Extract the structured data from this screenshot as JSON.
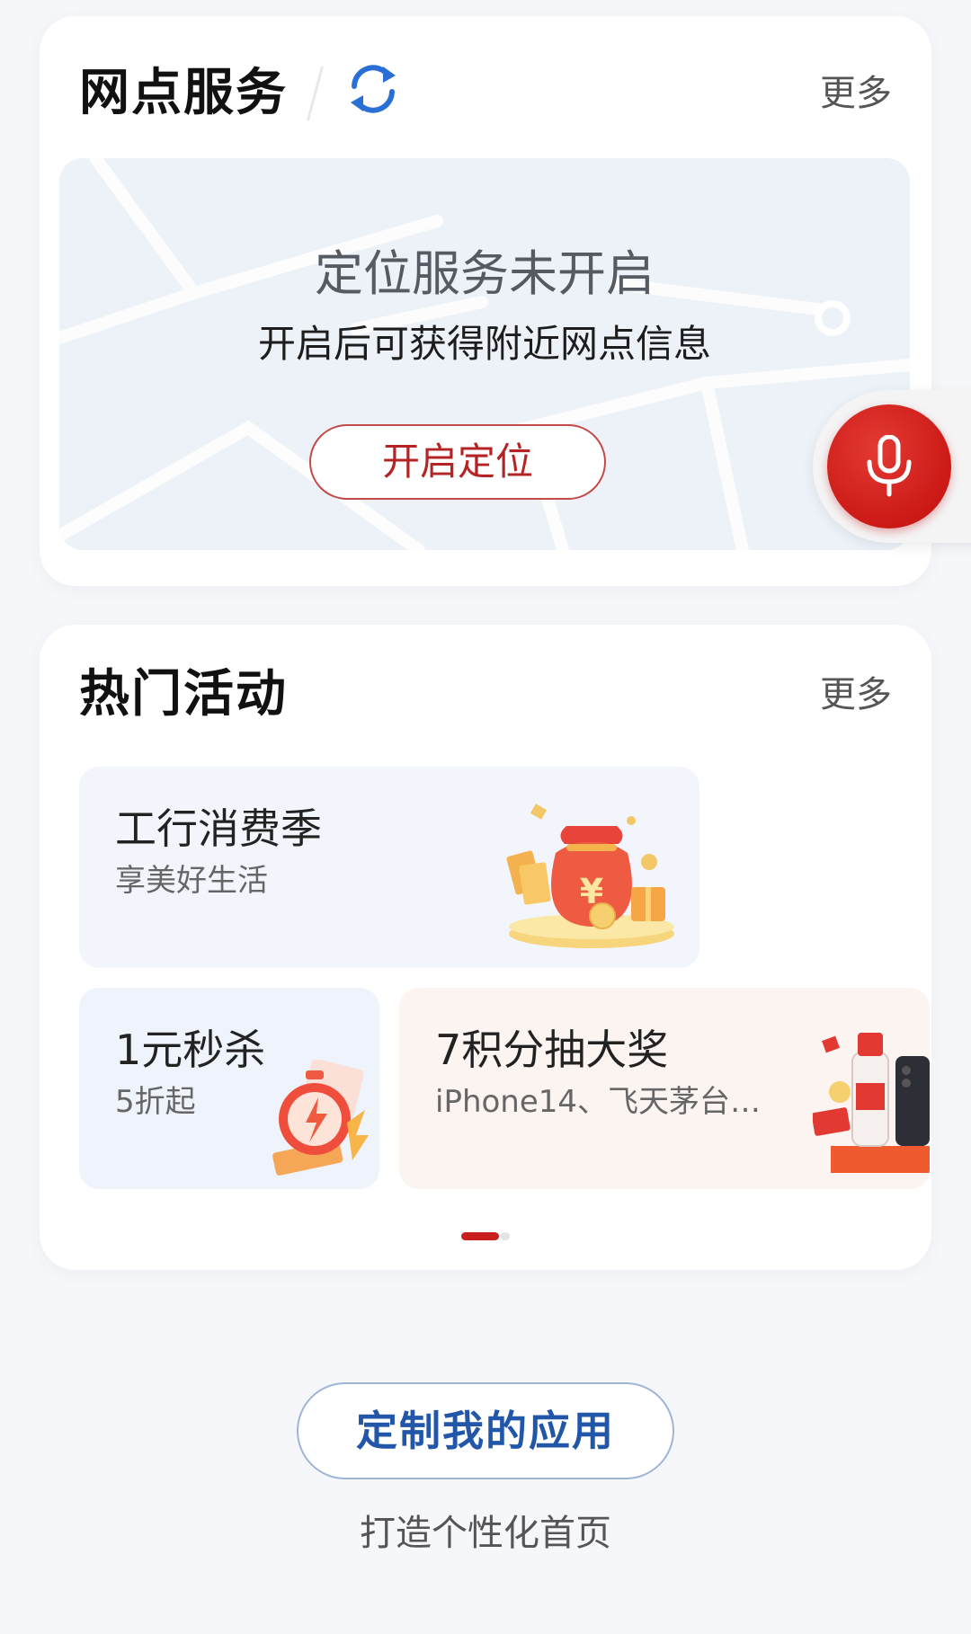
{
  "branch_service": {
    "title": "网点服务",
    "more": "更多",
    "map": {
      "title": "定位服务未开启",
      "subtitle": "开启后可获得附近网点信息",
      "button": "开启定位"
    }
  },
  "hot_activities": {
    "title": "热门活动",
    "more": "更多",
    "items": [
      {
        "title": "工行消费季",
        "subtitle": "享美好生活",
        "icon": "money-bag-icon"
      },
      {
        "title": "1元秒杀",
        "subtitle": "5折起",
        "icon": "stopwatch-icon"
      },
      {
        "title": "7积分抽大奖",
        "subtitle": "iPhone14、飞天茅台…",
        "icon": "prize-icon"
      }
    ],
    "carousel": {
      "pages": 2,
      "active": 1
    }
  },
  "customize": {
    "button": "定制我的应用",
    "subtitle": "打造个性化首页"
  },
  "voice_button": {
    "icon": "microphone-icon"
  },
  "colors": {
    "accent_red": "#c81e1e",
    "brand_blue": "#2256a8",
    "refresh_blue": "#2a6fd6"
  }
}
